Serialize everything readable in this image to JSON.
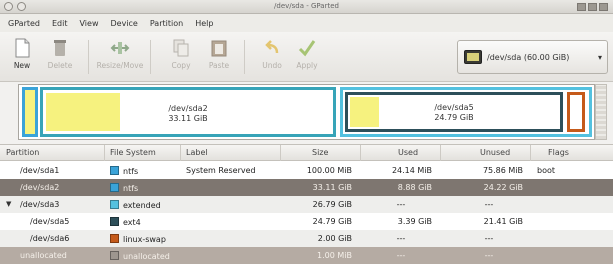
{
  "window": {
    "title": "/dev/sda - GParted"
  },
  "menu": [
    "GParted",
    "Edit",
    "View",
    "Device",
    "Partition",
    "Help"
  ],
  "toolbar": {
    "new": "New",
    "delete": "Delete",
    "resize_move": "Resize/Move",
    "copy": "Copy",
    "paste": "Paste",
    "undo": "Undo",
    "apply": "Apply"
  },
  "device_selector": {
    "label": "/dev/sda  (60.00 GiB)",
    "icon": "disk-icon"
  },
  "graph": {
    "sda2": {
      "name": "/dev/sda2",
      "size": "33.11 GiB",
      "used_fraction": 0.26
    },
    "sda5": {
      "name": "/dev/sda5",
      "size": "24.79 GiB",
      "used_fraction": 0.14
    }
  },
  "table": {
    "headers": [
      "Partition",
      "File System",
      "Label",
      "Size",
      "Used",
      "Unused",
      "Flags"
    ],
    "rows": [
      {
        "partition": "/dev/sda1",
        "fs": "ntfs",
        "fs_color": "#3aa3d8",
        "label": "System Reserved",
        "size": "100.00 MiB",
        "used": "24.14 MiB",
        "unused": "75.86 MiB",
        "flags": "boot"
      },
      {
        "partition": "/dev/sda2",
        "fs": "ntfs",
        "fs_color": "#3aa3d8",
        "label": "",
        "size": "33.11 GiB",
        "used": "8.88 GiB",
        "unused": "24.22 GiB",
        "flags": ""
      },
      {
        "partition": "/dev/sda3",
        "fs": "extended",
        "fs_color": "#53c1df",
        "label": "",
        "size": "26.79 GiB",
        "used": "---",
        "unused": "---",
        "flags": ""
      },
      {
        "partition": "/dev/sda5",
        "fs": "ext4",
        "fs_color": "#2d4f5a",
        "label": "",
        "size": "24.79 GiB",
        "used": "3.39 GiB",
        "unused": "21.41 GiB",
        "flags": ""
      },
      {
        "partition": "/dev/sda6",
        "fs": "linux-swap",
        "fs_color": "#c55a1a",
        "label": "",
        "size": "2.00 GiB",
        "used": "---",
        "unused": "---",
        "flags": ""
      },
      {
        "partition": "unallocated",
        "fs": "unallocated",
        "fs_color": "#9e968f",
        "label": "",
        "size": "1.00 MiB",
        "used": "---",
        "unused": "---",
        "flags": ""
      }
    ]
  },
  "colors": {
    "ntfs": "#3aa3d8",
    "extended": "#53c1df",
    "ext4": "#2d4f5a",
    "swap": "#c55a1a",
    "used": "#f6f27f"
  }
}
